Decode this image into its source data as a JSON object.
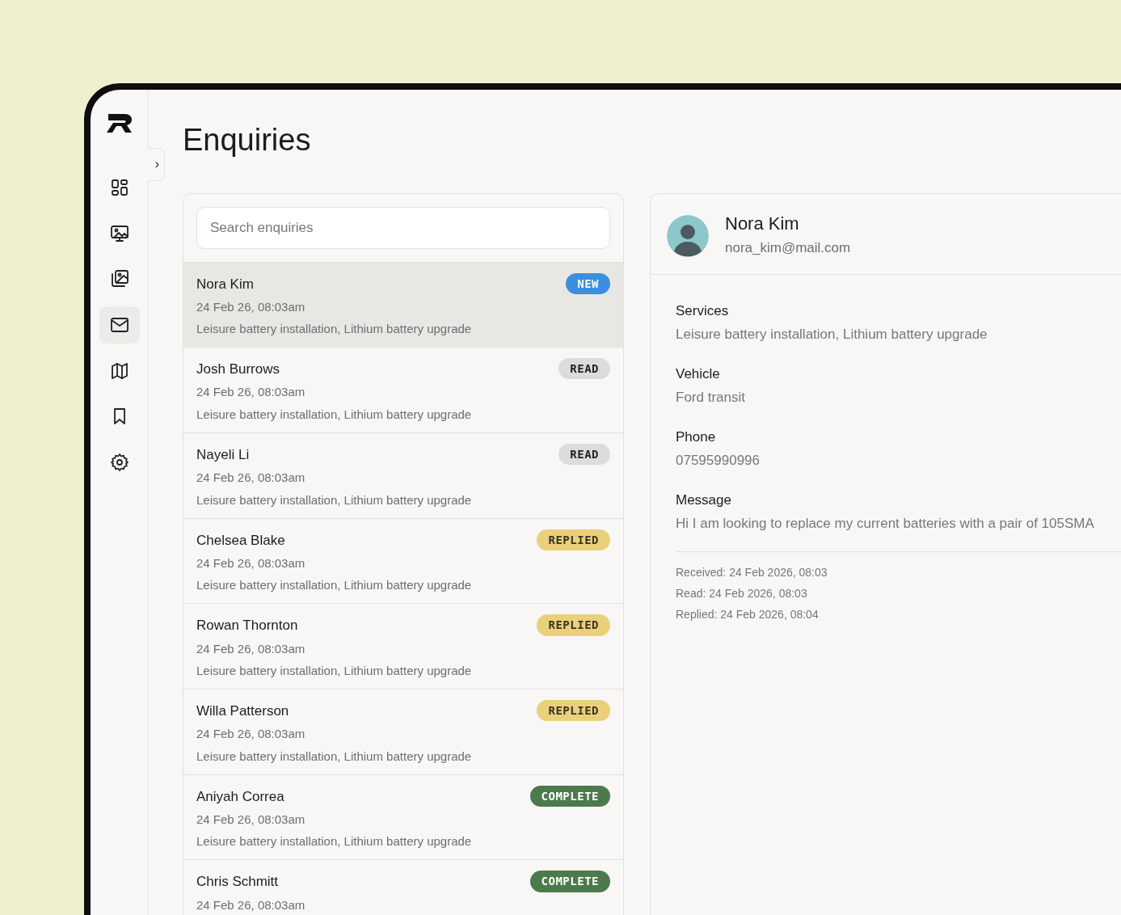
{
  "sidebar": {
    "items": [
      {
        "selected": false
      },
      {
        "selected": false
      },
      {
        "selected": false
      },
      {
        "selected": true
      },
      {
        "selected": false
      },
      {
        "selected": false
      },
      {
        "selected": false
      }
    ],
    "toggle": "›"
  },
  "page": {
    "title": "Enquiries"
  },
  "search": {
    "placeholder": "Search enquiries"
  },
  "enquiries": [
    {
      "name": "Nora Kim",
      "status": "NEW",
      "kind": "new",
      "date": "24 Feb 26, 08:03am",
      "services": "Leisure battery installation, Lithium battery upgrade",
      "selected": true
    },
    {
      "name": "Josh Burrows",
      "status": "READ",
      "kind": "read",
      "date": "24 Feb 26, 08:03am",
      "services": "Leisure battery installation, Lithium battery upgrade",
      "selected": false
    },
    {
      "name": "Nayeli Li",
      "status": "READ",
      "kind": "read",
      "date": "24 Feb 26, 08:03am",
      "services": "Leisure battery installation, Lithium battery upgrade",
      "selected": false
    },
    {
      "name": "Chelsea Blake",
      "status": "REPLIED",
      "kind": "replied",
      "date": "24 Feb 26, 08:03am",
      "services": "Leisure battery installation, Lithium battery upgrade",
      "selected": false
    },
    {
      "name": "Rowan Thornton",
      "status": "REPLIED",
      "kind": "replied",
      "date": "24 Feb 26, 08:03am",
      "services": "Leisure battery installation, Lithium battery upgrade",
      "selected": false
    },
    {
      "name": "Willa Patterson",
      "status": "REPLIED",
      "kind": "replied",
      "date": "24 Feb 26, 08:03am",
      "services": "Leisure battery installation, Lithium battery upgrade",
      "selected": false
    },
    {
      "name": "Aniyah Correa",
      "status": "COMPLETE",
      "kind": "complete",
      "date": "24 Feb 26, 08:03am",
      "services": "Leisure battery installation, Lithium battery upgrade",
      "selected": false
    },
    {
      "name": "Chris Schmitt",
      "status": "COMPLETE",
      "kind": "complete",
      "date": "24 Feb 26, 08:03am",
      "selected": false
    }
  ],
  "detail": {
    "name": "Nora Kim",
    "email": "nora_kim@mail.com",
    "fields": [
      {
        "label": "Services",
        "value": "Leisure battery installation, Lithium battery upgrade"
      },
      {
        "label": "Vehicle",
        "value": "Ford transit"
      },
      {
        "label": "Phone",
        "value": "07595990996"
      },
      {
        "label": "Message",
        "value": "Hi I am looking to replace my current batteries with a pair of 105SMA"
      }
    ],
    "timeline": [
      "Received: 24 Feb 2026, 08:03",
      "Read: 24 Feb 2026, 08:03",
      "Replied: 24 Feb 2026, 08:04"
    ]
  }
}
